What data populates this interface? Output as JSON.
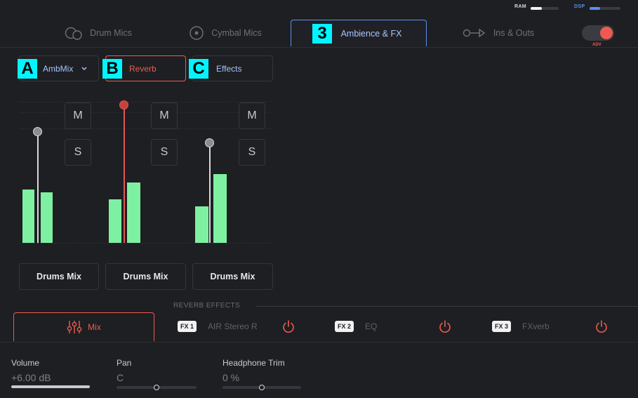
{
  "resources": {
    "ram_label": "RAM",
    "dsp_label": "DSP",
    "ram_level": 0.4,
    "dsp_level": 0.35
  },
  "tabs": [
    {
      "label": "Drum Mics",
      "icon": "drum-mics-icon"
    },
    {
      "label": "Cymbal Mics",
      "icon": "cymbal-icon"
    },
    {
      "label": "Ambience & FX",
      "icon": "",
      "active": true
    },
    {
      "label": "Ins & Outs",
      "icon": "routing-arrow-icon"
    }
  ],
  "adv_toggle": {
    "label": "ADV",
    "on": true
  },
  "annotations": {
    "tab_badge": "3",
    "a": "A",
    "b": "B",
    "c": "C"
  },
  "subtabs": {
    "ambmix": "AmbMix",
    "reverb": "Reverb",
    "effects": "Effects"
  },
  "channels": [
    {
      "mute": "M",
      "solo": "S",
      "name": "Drums Mix",
      "fader_level": 0.79,
      "meter_levels": [
        0.38,
        0.36
      ]
    },
    {
      "mute": "M",
      "solo": "S",
      "name": "Drums Mix",
      "fader_level": 0.98,
      "meter_levels": [
        0.31,
        0.43
      ]
    },
    {
      "mute": "M",
      "solo": "S",
      "name": "Drums Mix",
      "fader_level": 0.71,
      "meter_levels": [
        0.26,
        0.49
      ]
    }
  ],
  "reverb_effects": {
    "title": "REVERB EFFECTS",
    "mix_label": "Mix",
    "slots": [
      {
        "badge": "FX 1",
        "name": "AIR Stereo R"
      },
      {
        "badge": "FX 2",
        "name": "EQ"
      },
      {
        "badge": "FX 3",
        "name": "FXverb"
      }
    ]
  },
  "controls": {
    "volume": {
      "label": "Volume",
      "value": "+6.00 dB",
      "level": 1.0
    },
    "pan": {
      "label": "Pan",
      "value": "C",
      "level": 0.5
    },
    "trim": {
      "label": "Headphone Trim",
      "value": "0 %",
      "level": 0.5
    }
  },
  "colors": {
    "accent_red": "#ee5a52",
    "accent_blue": "#5b8ff0",
    "meter_green": "#7ef0a2",
    "badge_cyan": "#00f5ff"
  }
}
